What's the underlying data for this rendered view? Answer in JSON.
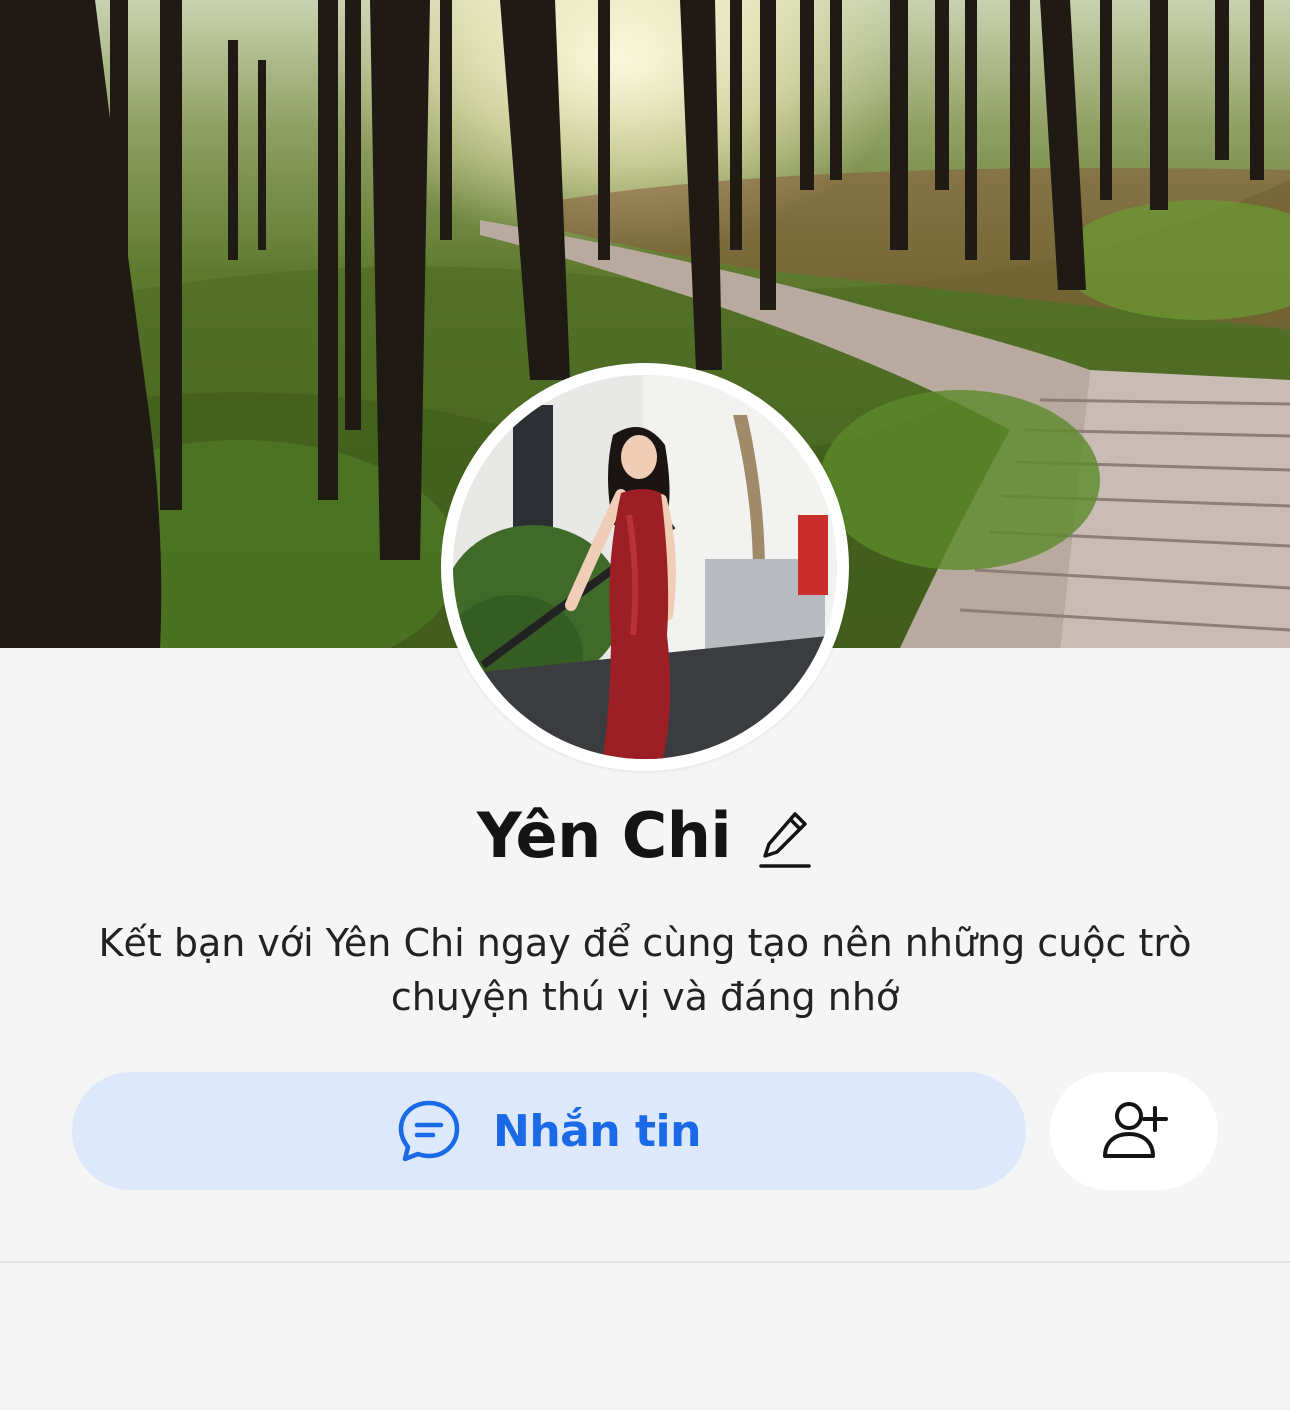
{
  "profile": {
    "name": "Yên Chi",
    "bio": "Kết bạn với Yên Chi ngay để cùng tạo nên những cuộc trò chuyện thú vị và đáng nhớ"
  },
  "actions": {
    "message_label": "Nhắn tin",
    "message_icon": "chat-bubble-icon",
    "add_friend_icon": "add-friend-icon",
    "edit_icon": "pencil-icon"
  },
  "colors": {
    "accent": "#1a6ae8",
    "message_button_bg": "#dde8fb",
    "background": "#f5f5f5"
  }
}
